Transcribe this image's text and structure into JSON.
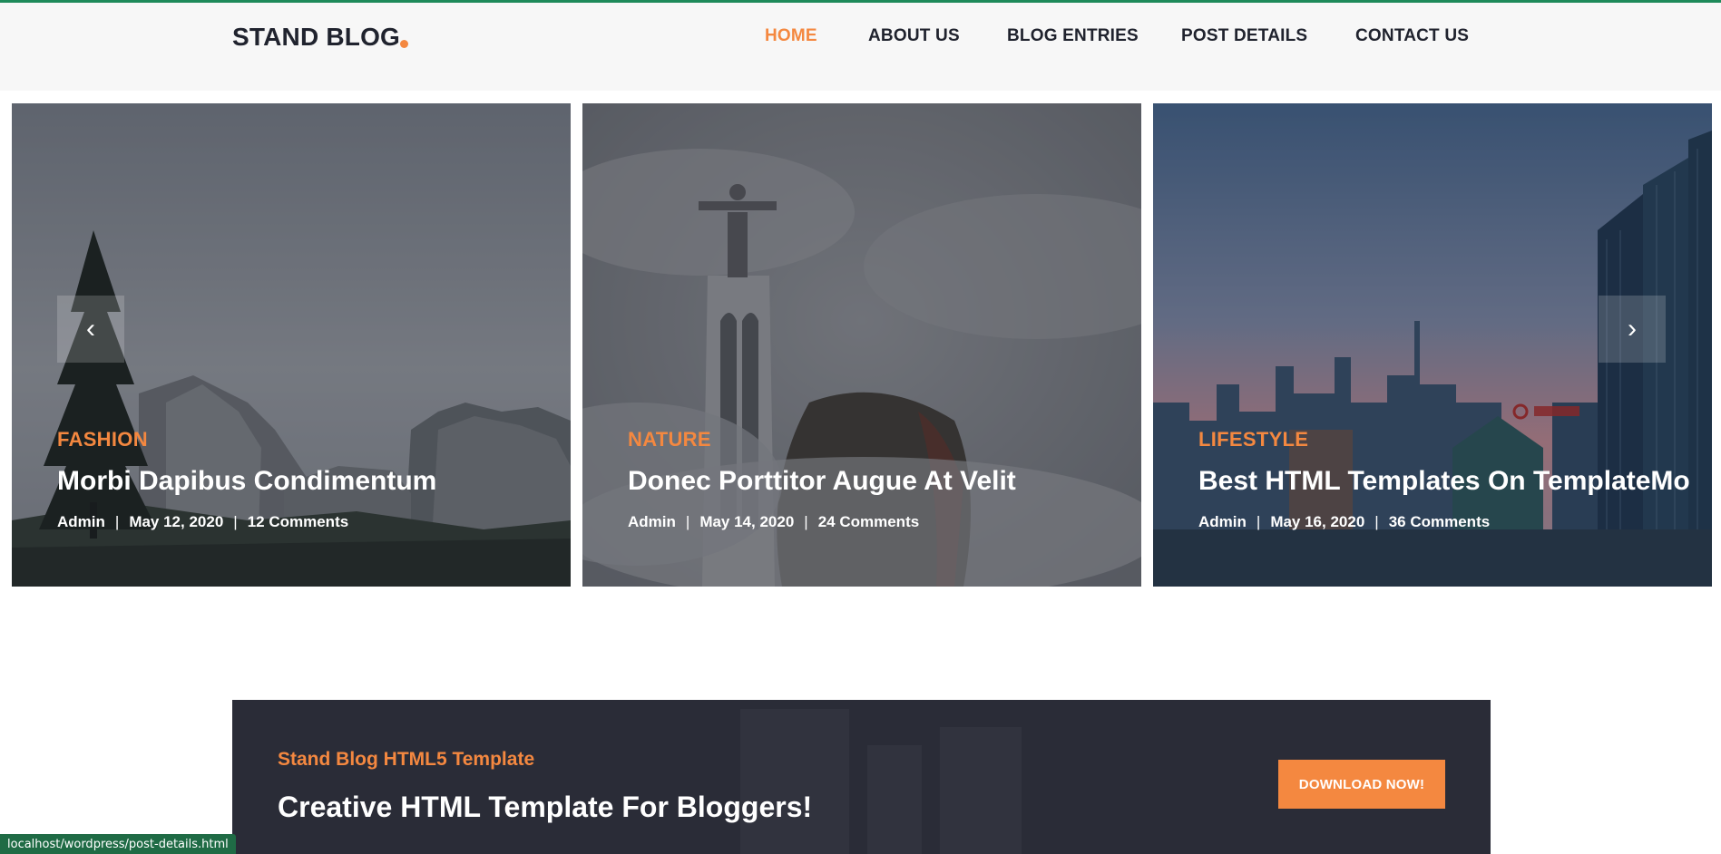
{
  "header": {
    "logo": "STAND BLOG",
    "nav": [
      {
        "label": "Home",
        "active": true
      },
      {
        "label": "About Us",
        "active": false
      },
      {
        "label": "Blog Entries",
        "active": false
      },
      {
        "label": "Post Details",
        "active": false
      },
      {
        "label": "Contact Us",
        "active": false
      }
    ]
  },
  "slider": {
    "prev_icon": "chevron-left-icon",
    "next_icon": "chevron-right-icon",
    "prev_glyph": "‹",
    "next_glyph": "›",
    "posts": [
      {
        "category": "Fashion",
        "title": "Morbi Dapibus Condimentum",
        "author": "Admin",
        "date": "May 12, 2020",
        "comments": "12 Comments",
        "meta_separator": "|"
      },
      {
        "category": "Nature",
        "title": "Donec Porttitor Augue At Velit",
        "author": "Admin",
        "date": "May 14, 2020",
        "comments": "24 Comments",
        "meta_separator": "|"
      },
      {
        "category": "Lifestyle",
        "title": "Best HTML Templates On TemplateMo",
        "author": "Admin",
        "date": "May 16, 2020",
        "comments": "36 Comments",
        "meta_separator": "|"
      }
    ]
  },
  "banner": {
    "subtitle": "Stand Blog HTML5 Template",
    "title": "Creative HTML Template For Bloggers!",
    "button": "Download Now!"
  },
  "status_bar": {
    "url": "localhost/wordpress/post-details.html"
  },
  "colors": {
    "accent": "#f48840",
    "dark": "#20232e",
    "banner_bg": "#2a2c37",
    "top_line": "#1e8a5a"
  }
}
